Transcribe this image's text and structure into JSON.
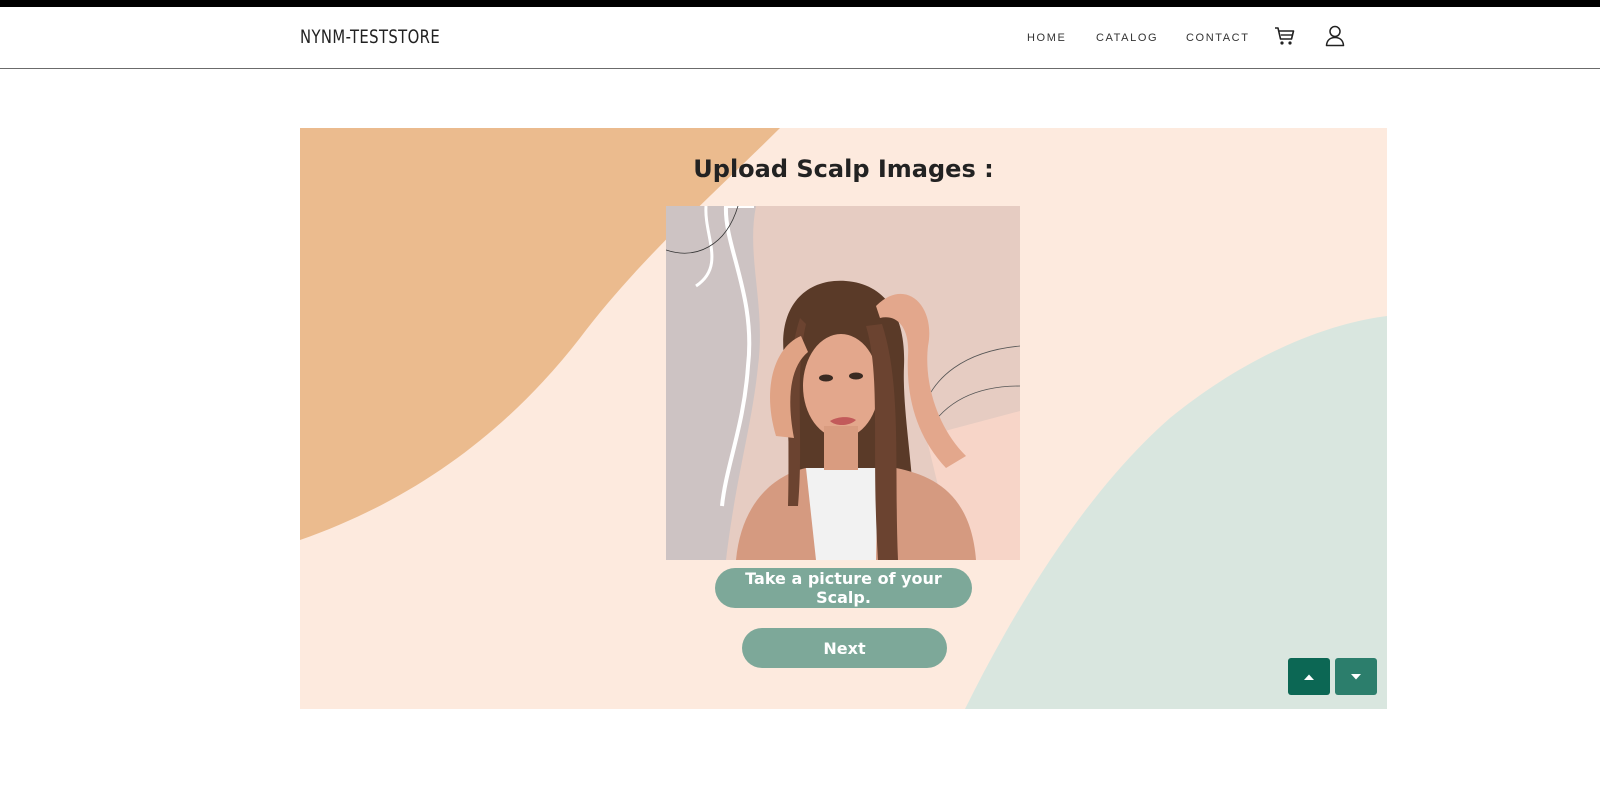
{
  "header": {
    "logo": "NYNM-TESTSTORE",
    "nav": {
      "home": "HOME",
      "catalog": "CATALOG",
      "contact": "CONTACT"
    },
    "icons": [
      "cart-icon",
      "user-icon"
    ]
  },
  "main": {
    "title": "Upload Scalp Images :",
    "photo_icon": "scalp-photo",
    "camera_button": "Take a picture of your Scalp.",
    "next_button": "Next"
  },
  "scroll_controls": {
    "up_icon": "arrow-up-icon",
    "down_icon": "arrow-down-icon"
  },
  "colors": {
    "hero_bg": "#fdeade",
    "orange_shape": "#ebbb8e",
    "green_shape": "#d9e6df",
    "button": "#7da899",
    "scroll_up": "#0c6754",
    "scroll_down": "#2c7e6c"
  }
}
